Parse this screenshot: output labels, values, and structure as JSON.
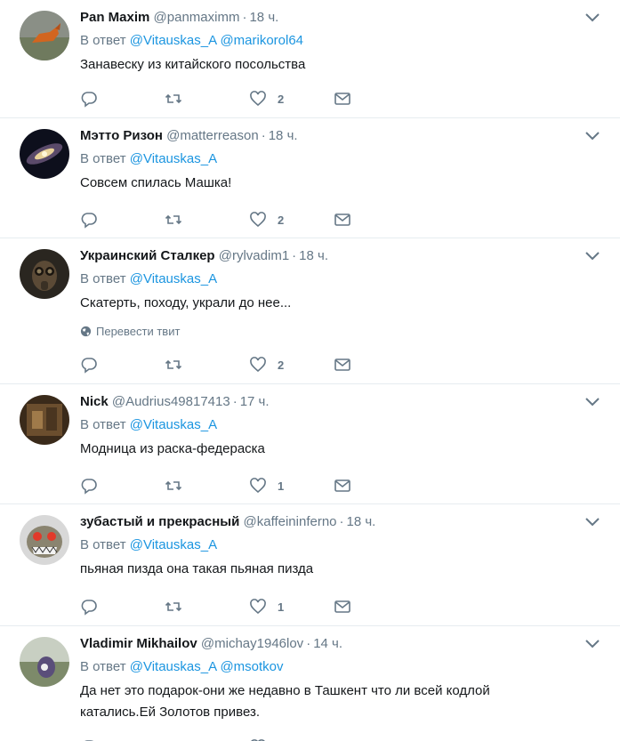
{
  "reply_prefix": "В ответ",
  "translate_label": "Перевести твит",
  "tweets": [
    {
      "name": "Pan Maxim",
      "handle": "@panmaximm",
      "time": "18 ч.",
      "mentions": [
        "@Vitauskas_A",
        "@marikorol64"
      ],
      "text": "Занавеску из китайского посольства",
      "likes": "2"
    },
    {
      "name": "Мэтто Ризон",
      "handle": "@matterreason",
      "time": "18 ч.",
      "mentions": [
        "@Vitauskas_A"
      ],
      "text": "Совсем спилась Машка!",
      "likes": "2"
    },
    {
      "name": "Украинский Сталкер",
      "handle": "@rylvadim1",
      "time": "18 ч.",
      "mentions": [
        "@Vitauskas_A"
      ],
      "text": "Скатерть, походу, украли до нее...",
      "likes": "2"
    },
    {
      "name": "Nick",
      "handle": "@Audrius49817413",
      "time": "17 ч.",
      "mentions": [
        "@Vitauskas_A"
      ],
      "text": "Модница из раска-федераска",
      "likes": "1"
    },
    {
      "name": "зубастый и прекрасный",
      "handle": "@kaffeininferno",
      "time": "18 ч.",
      "mentions": [
        "@Vitauskas_A"
      ],
      "text": "пьяная пизда она такая пьяная пизда",
      "likes": "1"
    },
    {
      "name": "Vladimir Mikhailov",
      "handle": "@michay1946lov",
      "time": "14 ч.",
      "mentions": [
        "@Vitauskas_A",
        "@msotkov"
      ],
      "text_line1": "Да нет это подарок-они же недавно в Ташкент что ли всей кодлой",
      "text_line2": "катались.Ей Золотов привез.",
      "likes": ""
    }
  ]
}
